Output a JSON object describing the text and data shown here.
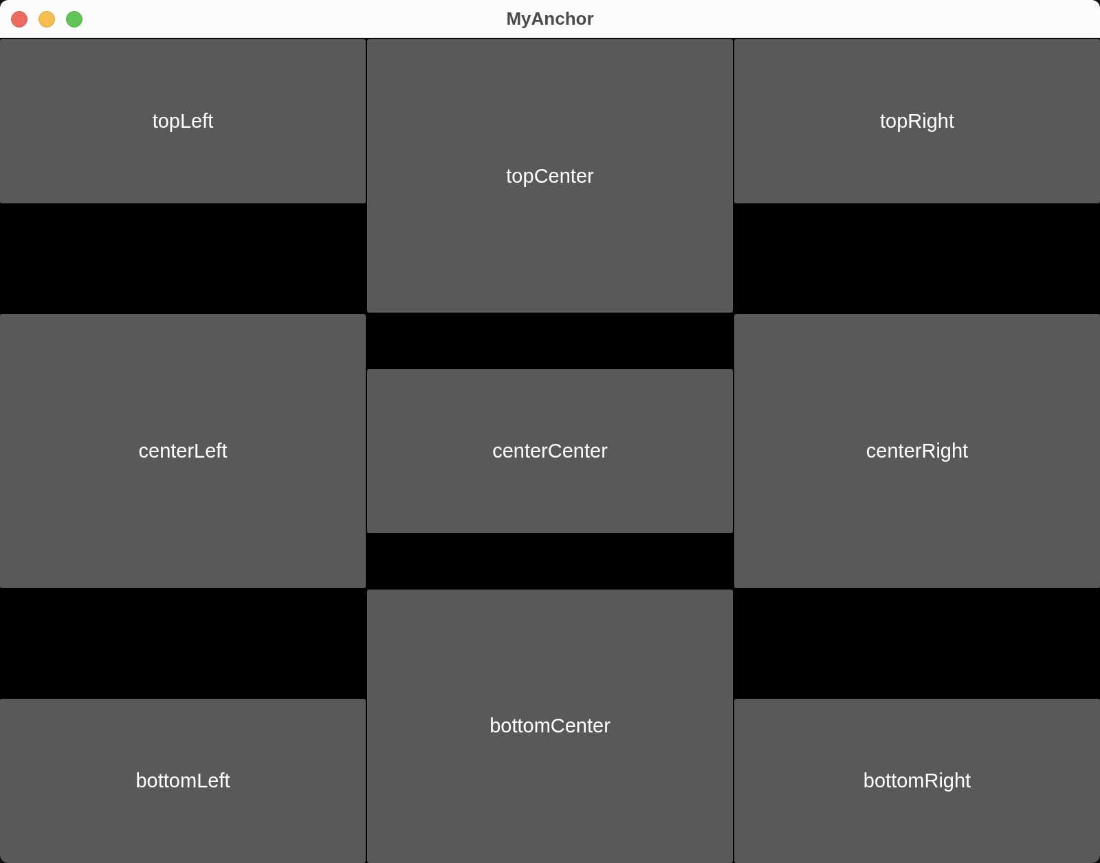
{
  "window": {
    "title": "MyAnchor"
  },
  "cells": [
    {
      "label": "topLeft",
      "kind": "top"
    },
    {
      "label": "topCenter",
      "kind": "full"
    },
    {
      "label": "topRight",
      "kind": "top"
    },
    {
      "label": "centerLeft",
      "kind": "full"
    },
    {
      "label": "centerCenter",
      "kind": "middle"
    },
    {
      "label": "centerRight",
      "kind": "full"
    },
    {
      "label": "bottomLeft",
      "kind": "bottom"
    },
    {
      "label": "bottomCenter",
      "kind": "full"
    },
    {
      "label": "bottomRight",
      "kind": "bottom"
    }
  ]
}
